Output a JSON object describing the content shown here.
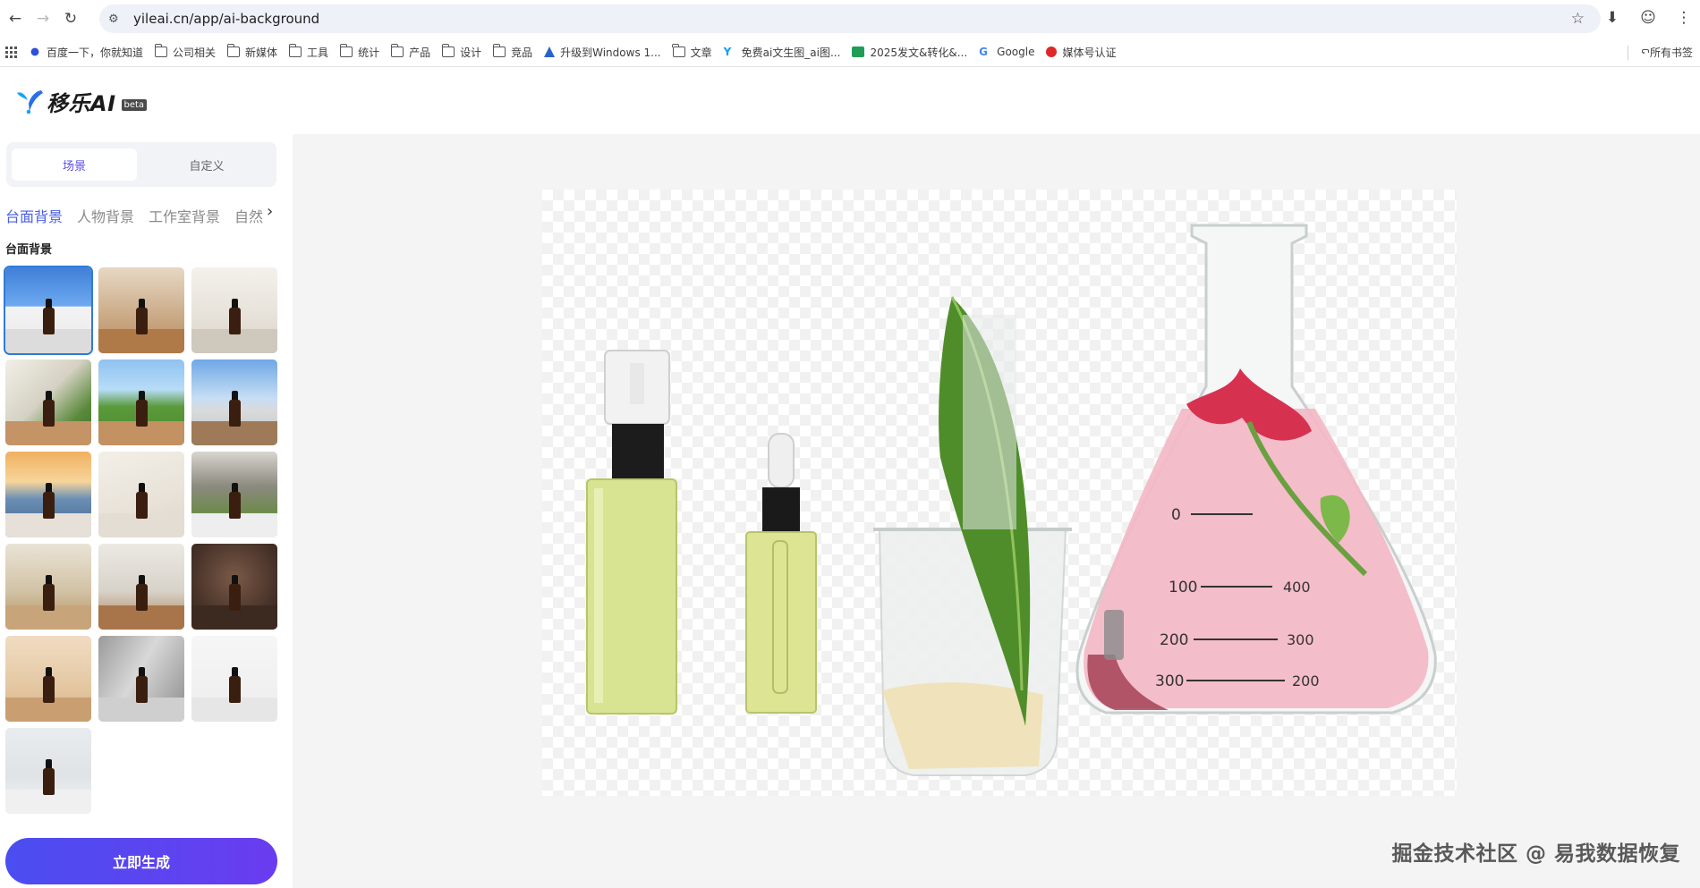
{
  "browser": {
    "url": "yileai.cn/app/ai-background",
    "bookmarks": [
      {
        "label": "百度一下，你就知道",
        "icon": "baidu-icon"
      },
      {
        "label": "公司相关",
        "icon": "folder-icon"
      },
      {
        "label": "新媒体",
        "icon": "folder-icon"
      },
      {
        "label": "工具",
        "icon": "folder-icon"
      },
      {
        "label": "统计",
        "icon": "folder-icon"
      },
      {
        "label": "产品",
        "icon": "folder-icon"
      },
      {
        "label": "设计",
        "icon": "folder-icon"
      },
      {
        "label": "竞品",
        "icon": "folder-icon"
      },
      {
        "label": "升级到Windows 1...",
        "icon": "windows-upgrade-icon"
      },
      {
        "label": "文章",
        "icon": "folder-icon"
      },
      {
        "label": "免费ai文生图_ai图...",
        "icon": "site-icon"
      },
      {
        "label": "2025发文&转化&...",
        "icon": "sheet-icon"
      },
      {
        "label": "Google",
        "icon": "google-icon"
      },
      {
        "label": "媒体号认证",
        "icon": "weibo-icon"
      }
    ],
    "all_bookmarks_label": "所有书签"
  },
  "app": {
    "logo_text": "移乐AI",
    "beta_label": "beta",
    "accent_color": "#4a5fe0"
  },
  "sidebar": {
    "modes": [
      "场景",
      "自定义"
    ],
    "categories": [
      "台面背景",
      "人物背景",
      "工作室背景",
      "自然"
    ],
    "section_title": "台面背景",
    "thumbnails": [
      {
        "scene": "seaside-arch",
        "selected": true
      },
      {
        "scene": "wooden-shelf-room"
      },
      {
        "scene": "bright-bathroom"
      },
      {
        "scene": "palm-leaf-table"
      },
      {
        "scene": "garden-lawn"
      },
      {
        "scene": "sky-terrace"
      },
      {
        "scene": "sunset-beach"
      },
      {
        "scene": "cream-fabric"
      },
      {
        "scene": "white-flowers-window"
      },
      {
        "scene": "rattan-flowers"
      },
      {
        "scene": "flowers-wood-table"
      },
      {
        "scene": "dark-studio"
      },
      {
        "scene": "warm-wood-studio"
      },
      {
        "scene": "grey-shadow"
      },
      {
        "scene": "white-pedestal"
      },
      {
        "scene": "marble-kitchen"
      }
    ],
    "generate_button": "立即生成"
  },
  "main": {
    "flask_scale_left": [
      "0",
      "100",
      "200",
      "300"
    ],
    "flask_scale_right": [
      "400",
      "300",
      "200"
    ],
    "watermark": "掘金技术社区 @ 易我数据恢复"
  }
}
